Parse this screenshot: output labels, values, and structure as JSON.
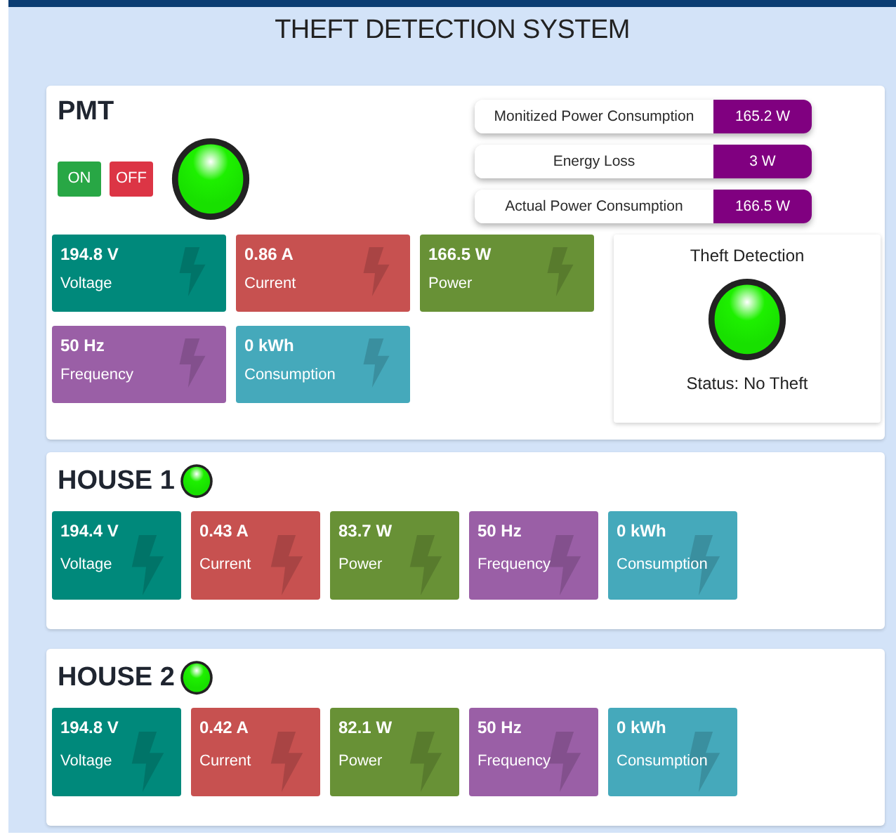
{
  "title": "THEFT DETECTION SYSTEM",
  "pmt": {
    "name": "PMT",
    "buttons": [
      {
        "label": "ON",
        "kind": "on"
      },
      {
        "label": "OFF",
        "kind": "off"
      }
    ],
    "lamp_on": true,
    "readings": [
      {
        "label": "Monitized Power Consumption",
        "value": "165.2 W"
      },
      {
        "label": "Energy Loss",
        "value": "3 W"
      },
      {
        "label": "Actual Power Consumption",
        "value": "166.5 W"
      }
    ],
    "tiles": [
      {
        "value": "194.8 V",
        "label": "Voltage",
        "color": "#00897b"
      },
      {
        "value": "0.86 A",
        "label": "Current",
        "color": "#c75150"
      },
      {
        "value": "166.5 W",
        "label": "Power",
        "color": "#689136"
      },
      {
        "value": "50 Hz",
        "label": "Frequency",
        "color": "#9a5fa6"
      },
      {
        "value": "0 kWh",
        "label": "Consumption",
        "color": "#45a9bb"
      }
    ],
    "theft": {
      "title": "Theft Detection",
      "lamp_on": true,
      "status": "Status: No Theft"
    }
  },
  "houses": [
    {
      "name": "HOUSE 1",
      "lamp_on": true,
      "tiles": [
        {
          "value": "194.4 V",
          "label": "Voltage",
          "color": "#00897b"
        },
        {
          "value": "0.43 A",
          "label": "Current",
          "color": "#c75150"
        },
        {
          "value": "83.7 W",
          "label": "Power",
          "color": "#689136"
        },
        {
          "value": "50 Hz",
          "label": "Frequency",
          "color": "#9a5fa6"
        },
        {
          "value": "0 kWh",
          "label": "Consumption",
          "color": "#45a9bb"
        }
      ]
    },
    {
      "name": "HOUSE 2",
      "lamp_on": true,
      "tiles": [
        {
          "value": "194.8 V",
          "label": "Voltage",
          "color": "#00897b"
        },
        {
          "value": "0.42 A",
          "label": "Current",
          "color": "#c75150"
        },
        {
          "value": "82.1 W",
          "label": "Power",
          "color": "#689136"
        },
        {
          "value": "50 Hz",
          "label": "Frequency",
          "color": "#9a5fa6"
        },
        {
          "value": "0 kWh",
          "label": "Consumption",
          "color": "#45a9bb"
        }
      ]
    }
  ]
}
